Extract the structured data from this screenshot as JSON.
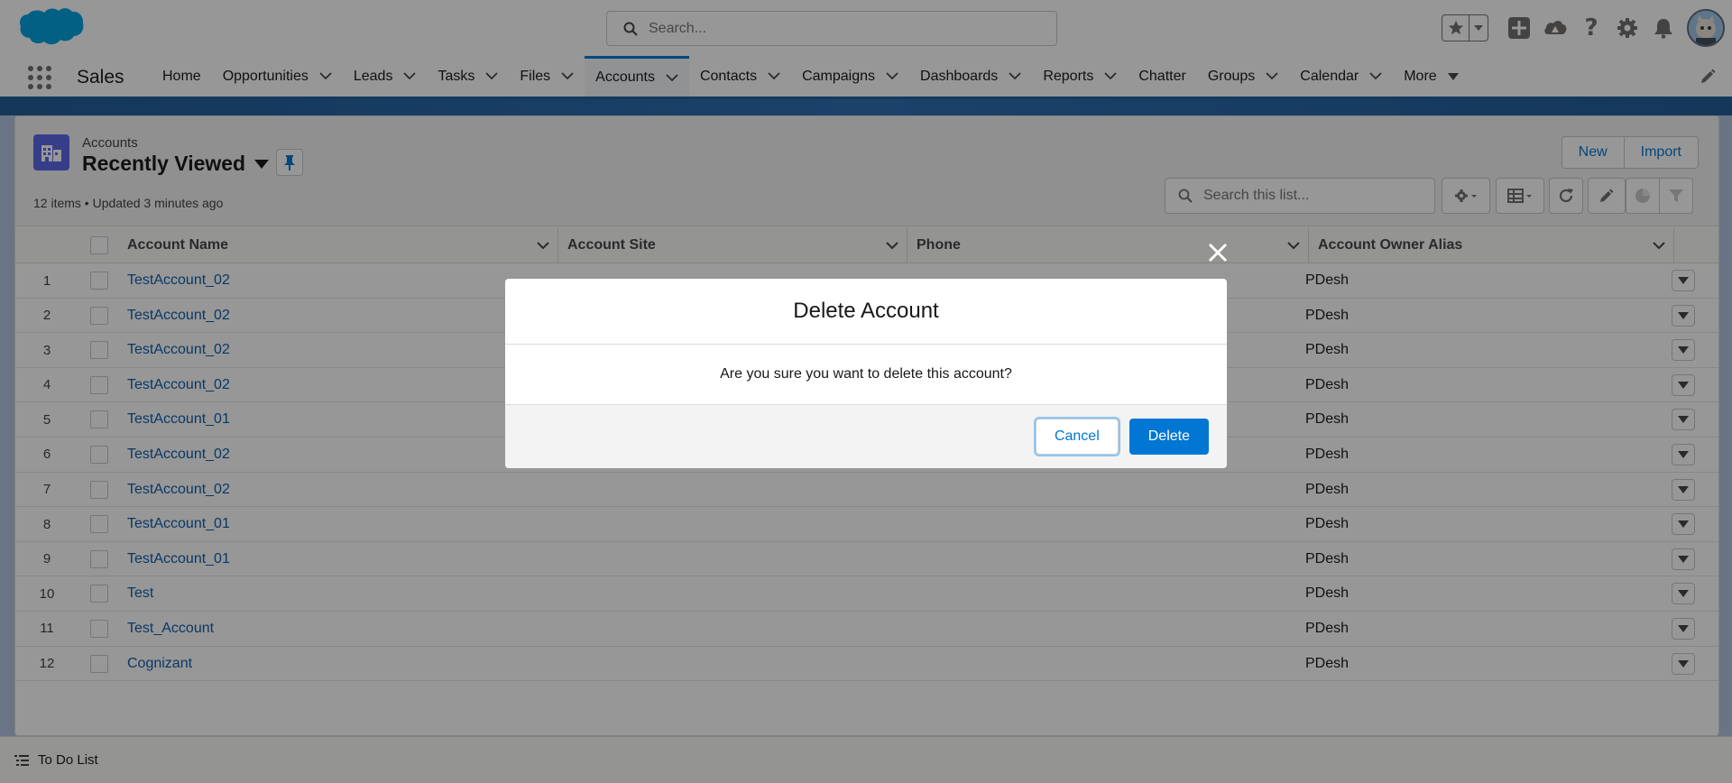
{
  "header": {
    "search_placeholder": "Search...",
    "icons": [
      "favorites-star-icon",
      "favorites-menu-icon",
      "global-actions-icon",
      "trailhead-icon",
      "help-icon",
      "setup-gear-icon",
      "notifications-bell-icon",
      "user-avatar"
    ]
  },
  "nav": {
    "app_name": "Sales",
    "items": [
      {
        "label": "Home",
        "chevron": false
      },
      {
        "label": "Opportunities",
        "chevron": true
      },
      {
        "label": "Leads",
        "chevron": true
      },
      {
        "label": "Tasks",
        "chevron": true
      },
      {
        "label": "Files",
        "chevron": true
      },
      {
        "label": "Accounts",
        "chevron": true,
        "active": true
      },
      {
        "label": "Contacts",
        "chevron": true
      },
      {
        "label": "Campaigns",
        "chevron": true
      },
      {
        "label": "Dashboards",
        "chevron": true
      },
      {
        "label": "Reports",
        "chevron": true
      },
      {
        "label": "Chatter",
        "chevron": false
      },
      {
        "label": "Groups",
        "chevron": true
      },
      {
        "label": "Calendar",
        "chevron": true
      },
      {
        "label": "More",
        "chevron": true
      }
    ]
  },
  "list_view": {
    "object_label": "Accounts",
    "view_name": "Recently Viewed",
    "info": "12 items • Updated 3 minutes ago",
    "new_label": "New",
    "import_label": "Import",
    "search_placeholder": "Search this list..."
  },
  "table": {
    "columns": [
      "Account Name",
      "Account Site",
      "Phone",
      "Account Owner Alias"
    ],
    "rows": [
      {
        "num": "1",
        "name": "TestAccount_02",
        "owner": "PDesh"
      },
      {
        "num": "2",
        "name": "TestAccount_02",
        "owner": "PDesh"
      },
      {
        "num": "3",
        "name": "TestAccount_02",
        "owner": "PDesh"
      },
      {
        "num": "4",
        "name": "TestAccount_02",
        "owner": "PDesh"
      },
      {
        "num": "5",
        "name": "TestAccount_01",
        "owner": "PDesh"
      },
      {
        "num": "6",
        "name": "TestAccount_02",
        "owner": "PDesh"
      },
      {
        "num": "7",
        "name": "TestAccount_02",
        "owner": "PDesh"
      },
      {
        "num": "8",
        "name": "TestAccount_01",
        "owner": "PDesh"
      },
      {
        "num": "9",
        "name": "TestAccount_01",
        "owner": "PDesh"
      },
      {
        "num": "10",
        "name": "Test",
        "owner": "PDesh"
      },
      {
        "num": "11",
        "name": "Test_Account",
        "owner": "PDesh"
      },
      {
        "num": "12",
        "name": "Cognizant",
        "owner": "PDesh"
      }
    ]
  },
  "utility_bar": {
    "todo_label": "To Do List"
  },
  "modal": {
    "title": "Delete Account",
    "message": "Are you sure you want to delete this account?",
    "cancel_label": "Cancel",
    "delete_label": "Delete"
  },
  "colors": {
    "brand_blue": "#0176d3",
    "link_blue": "#0b5cab",
    "object_icon": "#5867e8"
  }
}
